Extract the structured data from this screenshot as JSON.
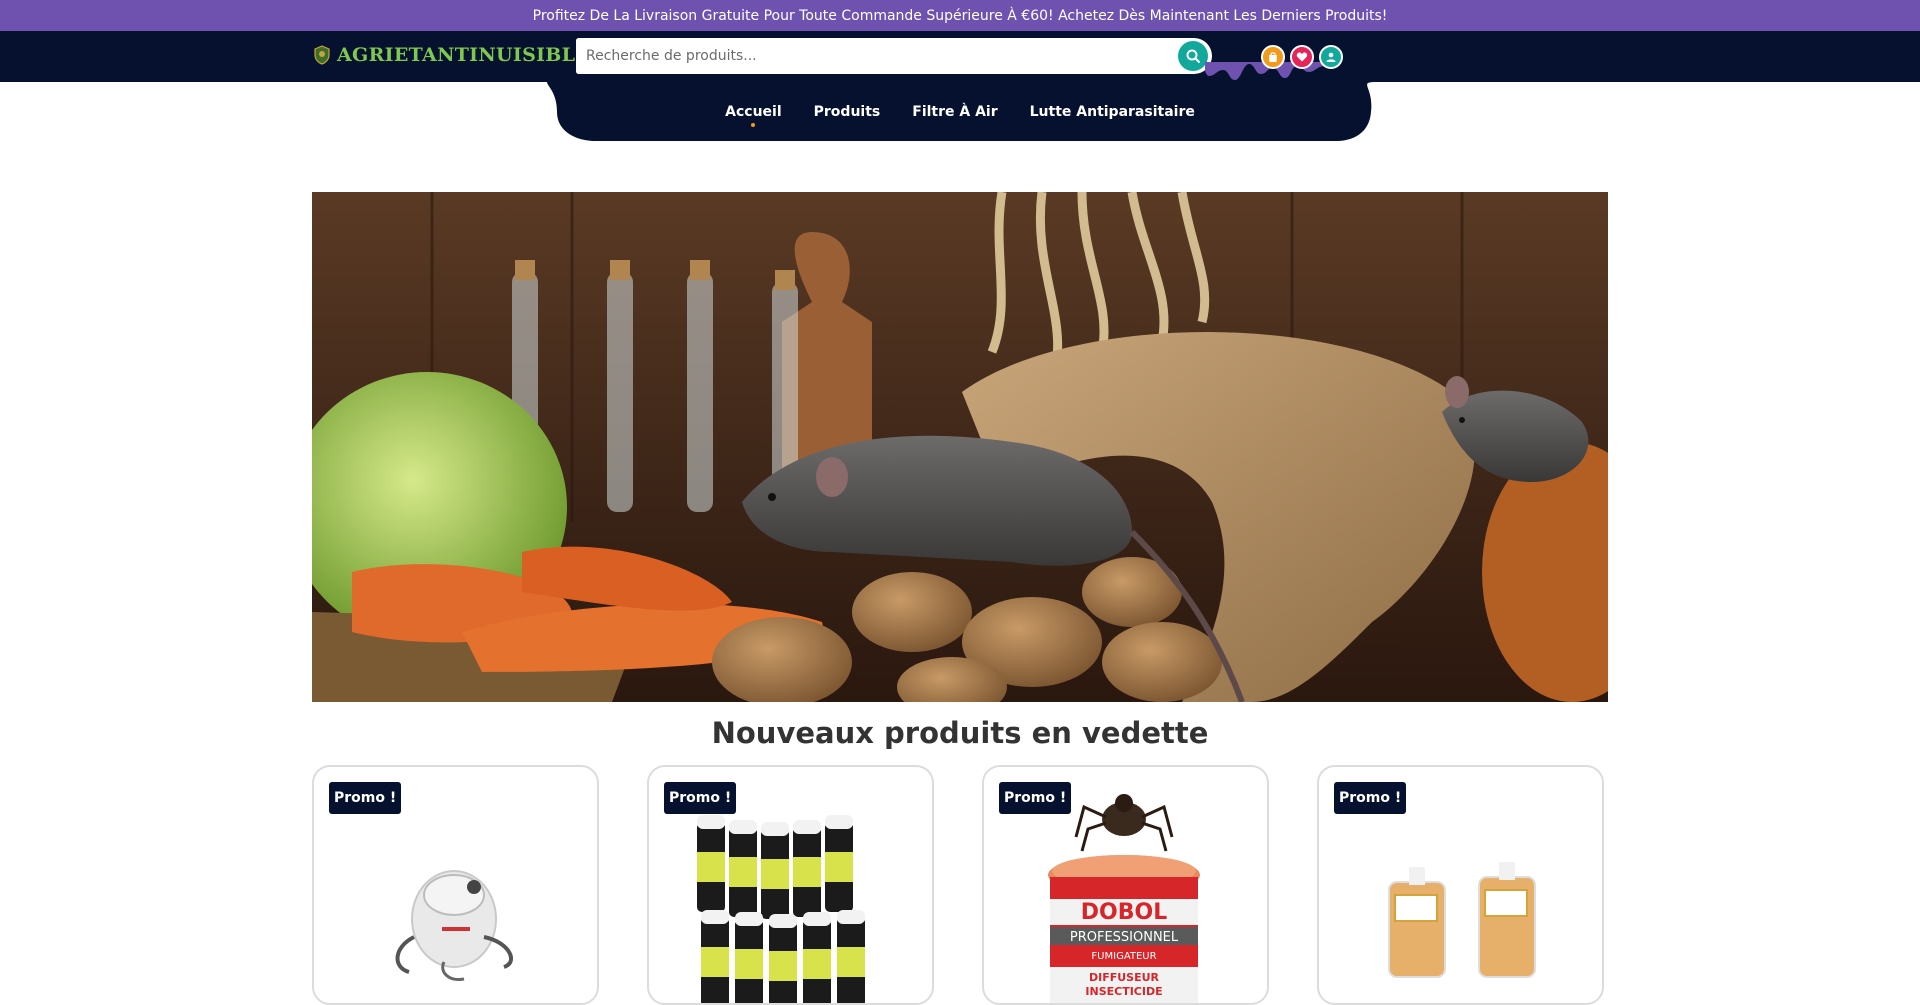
{
  "announcement": {
    "text": "Profitez De La Livraison Gratuite Pour Toute Commande Supérieure À €60! Achetez Dès Maintenant Les Derniers Produits!"
  },
  "header": {
    "logo_text": "AGRIETANTINUISIBLES",
    "search": {
      "placeholder": "Recherche de produits..."
    },
    "icons": [
      "shopping-bag-icon",
      "heart-icon",
      "user-icon"
    ]
  },
  "nav": {
    "items": [
      {
        "label": "Accueil",
        "active": true
      },
      {
        "label": "Produits",
        "active": false
      },
      {
        "label": "Filtre À Air",
        "active": false
      },
      {
        "label": "Lutte Antiparasitaire",
        "active": false
      }
    ]
  },
  "featured": {
    "title": "Nouveaux produits en vedette",
    "products": [
      {
        "badge": "Promo !"
      },
      {
        "badge": "Promo !"
      },
      {
        "badge": "Promo !",
        "brand": "DOBOL",
        "subbrand": "PROFESSIONNEL",
        "line3": "FUMIGATEUR",
        "line4": "DIFFUSEUR",
        "line5": "INSECTICIDE"
      },
      {
        "badge": "Promo !"
      }
    ]
  },
  "colors": {
    "promo_bar": "#6f52b0",
    "header_bg": "#05112f",
    "accent_teal": "#12a89c",
    "accent_orange": "#f39a1a",
    "accent_pink": "#e5245a",
    "logo_green": "#7ec850"
  }
}
